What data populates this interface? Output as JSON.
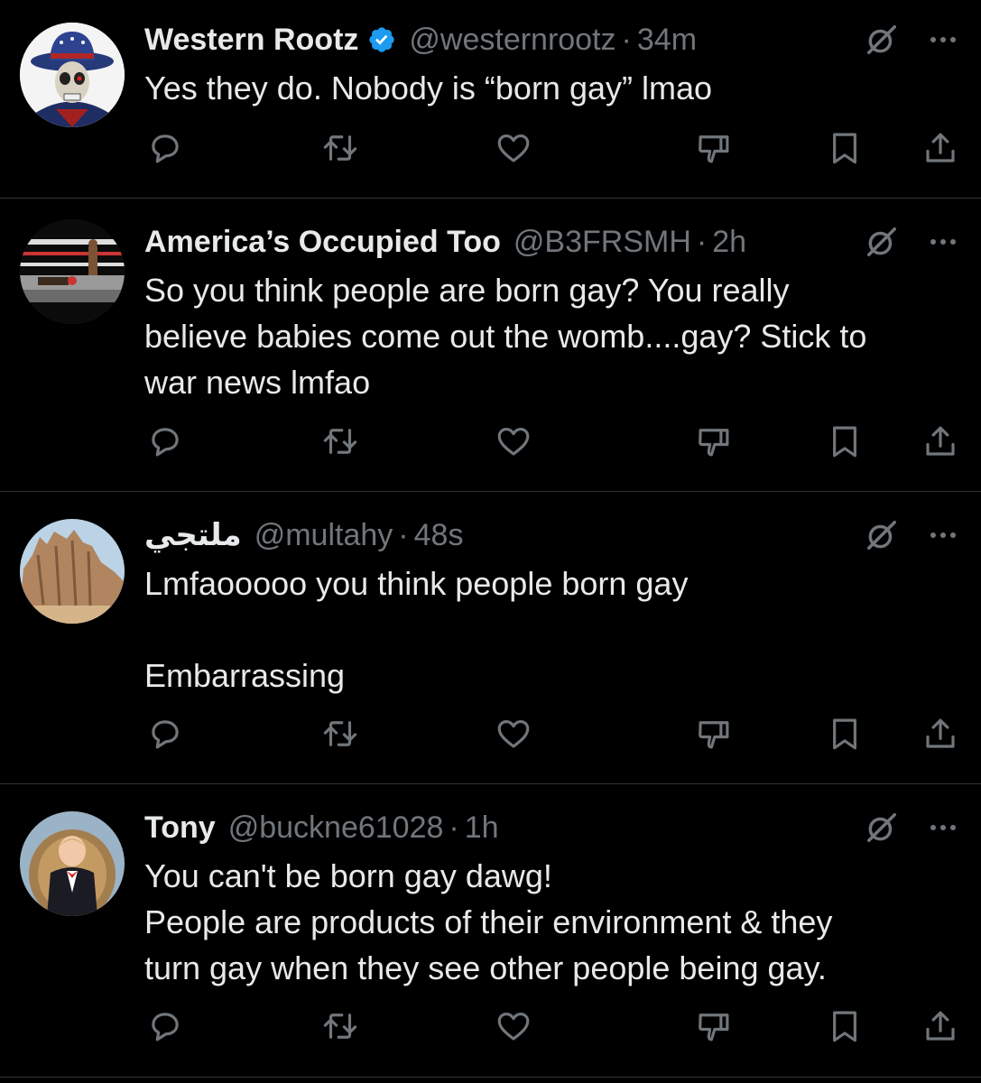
{
  "tweets": [
    {
      "name": "Western Rootz",
      "verified": true,
      "handle": "@westernrootz",
      "separator": "·",
      "time": "34m",
      "lines": [
        "Yes they do. Nobody is “born gay” lmao"
      ]
    },
    {
      "name": "America’s Occupied Too",
      "verified": false,
      "handle": "@B3FRSMH",
      "separator": "·",
      "time": "2h",
      "lines": [
        "So you think people are born gay? You really",
        "believe babies come out the womb....gay?  Stick to",
        "war news lmfao"
      ]
    },
    {
      "name": "ملتجي",
      "verified": false,
      "handle": "@multahy",
      "separator": "·",
      "time": "48s",
      "lines": [
        "Lmfaooooo you think people born gay",
        "",
        "Embarrassing"
      ]
    },
    {
      "name": "Tony",
      "verified": false,
      "handle": "@buckne61028",
      "separator": "·",
      "time": "1h",
      "lines": [
        "You can't be born gay dawg!",
        "People are products of their environment & they",
        "turn gay when they see other people being gay."
      ]
    }
  ],
  "icons": {
    "verified": "verified-badge-icon",
    "grok": "grok-icon",
    "more": "more-icon",
    "actions": [
      "reply-icon",
      "retweet-icon",
      "like-icon",
      "downvote-icon",
      "bookmark-icon",
      "share-icon"
    ]
  },
  "colors": {
    "background": "#000000",
    "text": "#e7e9ea",
    "muted": "#71767b",
    "verified": "#1d9bf0",
    "divider": "#2f3336"
  }
}
